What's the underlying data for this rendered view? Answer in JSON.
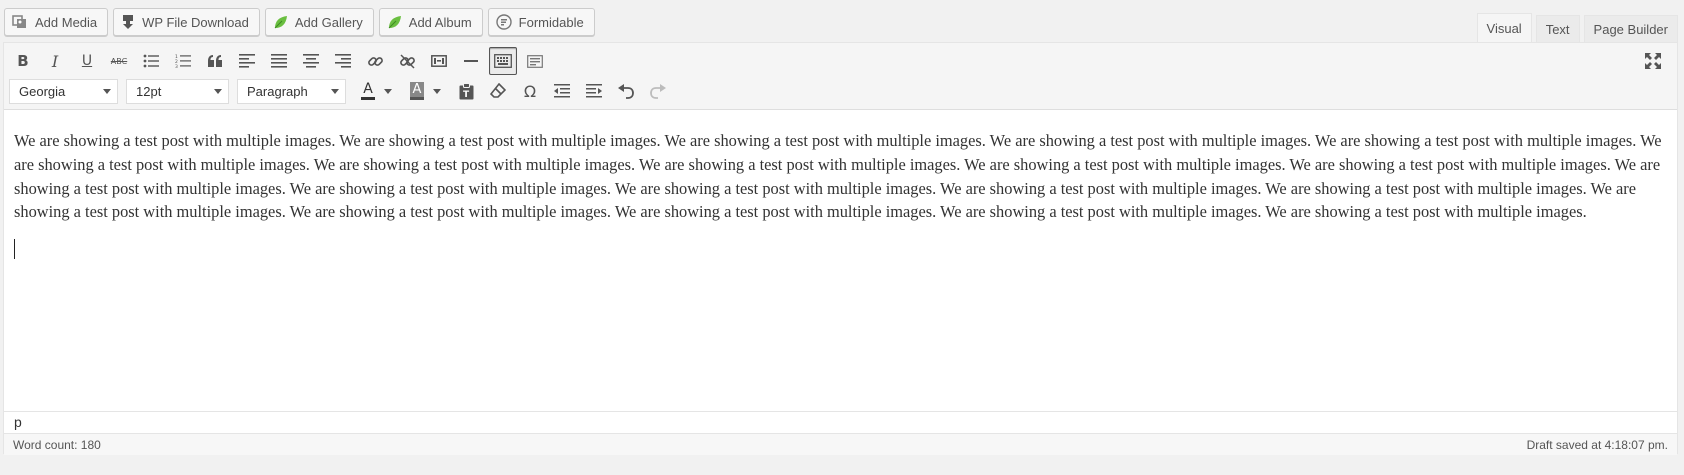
{
  "media_buttons": [
    {
      "label": "Add Media",
      "icon": "add-media-icon"
    },
    {
      "label": "WP File Download",
      "icon": "file-download-icon"
    },
    {
      "label": "Add Gallery",
      "icon": "leaf-icon"
    },
    {
      "label": "Add Album",
      "icon": "leaf-icon"
    },
    {
      "label": "Formidable",
      "icon": "formidable-icon"
    }
  ],
  "tabs": {
    "visual": "Visual",
    "text": "Text",
    "page_builder": "Page Builder",
    "active": "visual"
  },
  "toolbar": {
    "font_family": "Georgia",
    "font_size": "12pt",
    "block_format": "Paragraph",
    "row1_icons": [
      "bold-icon",
      "italic-icon",
      "underline-icon",
      "strikethrough-icon",
      "bullet-list-icon",
      "numbered-list-icon",
      "blockquote-icon",
      "align-left-icon",
      "align-justify-icon",
      "align-center-icon",
      "align-right-icon",
      "insert-link-icon",
      "remove-link-icon",
      "insert-more-icon",
      "horizontal-line-icon",
      "toolbar-toggle-icon",
      "page-break-icon",
      "fullscreen-icon"
    ],
    "row2_icons": [
      "text-color-icon",
      "background-color-icon",
      "paste-text-icon",
      "clear-formatting-icon",
      "special-character-icon",
      "outdent-icon",
      "indent-icon",
      "undo-icon",
      "redo-icon"
    ],
    "text_color": "#333333",
    "background_color": "#888888",
    "bold_letter": "B",
    "italic_letter": "I",
    "underline_letter": "U",
    "strike_letters": "ABC",
    "text_color_letter": "A",
    "bg_color_letter": "A",
    "omega": "Ω"
  },
  "content": {
    "paragraph": "We are showing a test post with multiple images. We are showing a test post with multiple images. We are showing a test post with multiple images. We are showing a test post with multiple images. We are showing a test post with multiple images. We are showing a test post with multiple images. We are showing a test post with multiple images. We are showing a test post with multiple images. We are showing a test post with multiple images. We are showing a test post with multiple images. We are showing a test post with multiple images. We are showing a test post with multiple images. We are showing a test post with multiple images. We are showing a test post with multiple images. We are showing a test post with multiple images. We are showing a test post with multiple images. We are showing a test post with multiple images. We are showing a test post with multiple images. We are showing a test post with multiple images. We are showing a test post with multiple images."
  },
  "path": "p",
  "status": {
    "word_count": "Word count: 180",
    "draft_saved": "Draft saved at 4:18:07 pm."
  },
  "colors": {
    "leaf_green": "#6abf40",
    "toolbar_bg": "#f5f5f5",
    "page_bg": "#f1f1f1"
  }
}
